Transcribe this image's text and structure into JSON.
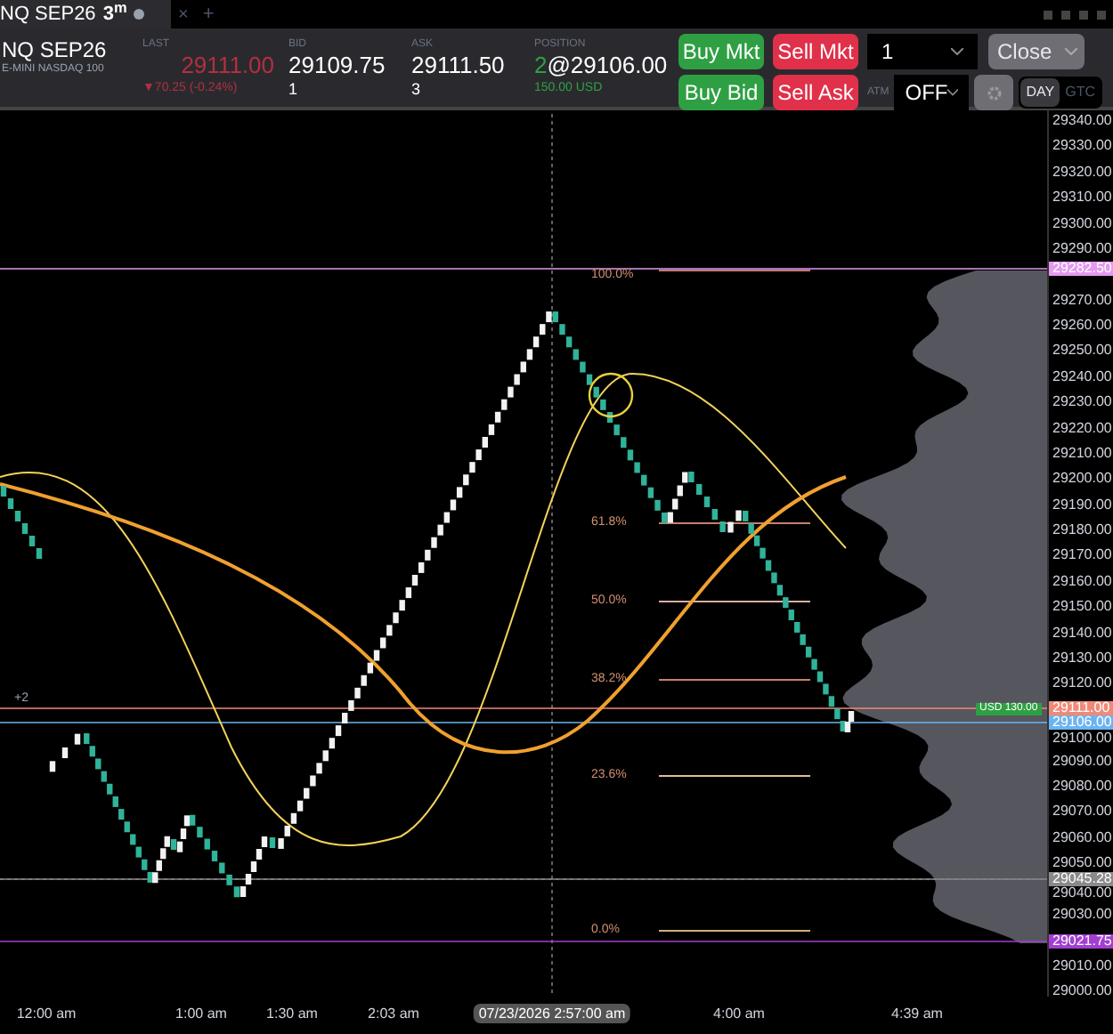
{
  "tab": {
    "title": "NQ SEP26",
    "interval": "3",
    "interval_unit": "m",
    "close": "×",
    "add": "+"
  },
  "instrument": {
    "symbol": "NQ SEP26",
    "name": "E-MINI NASDAQ 100"
  },
  "quotes": [
    {
      "label": "LAST",
      "value": "29111.00",
      "sub": "▼70.25 (-0.24%)",
      "kind": "last"
    },
    {
      "label": "BID",
      "value": "29109.75",
      "sub": "1",
      "kind": "plain"
    },
    {
      "label": "ASK",
      "value": "29111.50",
      "sub": "3",
      "kind": "plain"
    }
  ],
  "position": {
    "label": "POSITION",
    "qty": "2",
    "price": "@29106.00",
    "pnl": "150.00 USD"
  },
  "buttons": [
    {
      "label": "Buy Mkt",
      "kind": "buy"
    },
    {
      "label": "Sell Mkt",
      "kind": "sell"
    },
    {
      "label": "Buy Bid",
      "kind": "buy"
    },
    {
      "label": "Sell Ask",
      "kind": "sell"
    }
  ],
  "quantity": {
    "value": "1"
  },
  "close_button": {
    "label": "Close"
  },
  "atm": {
    "label": "ATM",
    "value": "OFF"
  },
  "tif": [
    {
      "label": "DAY",
      "selected": true
    },
    {
      "label": "GTC",
      "selected": false
    }
  ],
  "fib_levels": [
    "100.0%",
    "61.8%",
    "50.0%",
    "38.2%",
    "23.6%",
    "0.0%"
  ],
  "line_label": "+2",
  "pnl_badge": "USD 130.00",
  "price_axis": [
    "29340.00",
    "29330.00",
    "29320.00",
    "29310.00",
    "29300.00",
    "29290.00",
    "29270.00",
    "29260.00",
    "29250.00",
    "29240.00",
    "29230.00",
    "29220.00",
    "29210.00",
    "29200.00",
    "29190.00",
    "29180.00",
    "29170.00",
    "29160.00",
    "29150.00",
    "29140.00",
    "29130.00",
    "29120.00",
    "29100.00",
    "29090.00",
    "29080.00",
    "29070.00",
    "29060.00",
    "29050.00",
    "29040.00",
    "29030.00",
    "29010.00",
    "29000.00"
  ],
  "price_markers": [
    {
      "value": "29282.50",
      "color": "#e39af0"
    },
    {
      "value": "29111.00",
      "color": "#f08a78"
    },
    {
      "value": "29106.00",
      "color": "#6cb4f0"
    },
    {
      "value": "29045.28",
      "color": "#8a8a8a"
    },
    {
      "value": "29021.75",
      "color": "#a23fd1"
    }
  ],
  "time_axis": [
    "12:00 am",
    "1:00 am",
    "1:30 am",
    "2:03 am",
    "07/23/2026 2:57:00 am",
    "4:00 am",
    "4:39 am"
  ]
}
